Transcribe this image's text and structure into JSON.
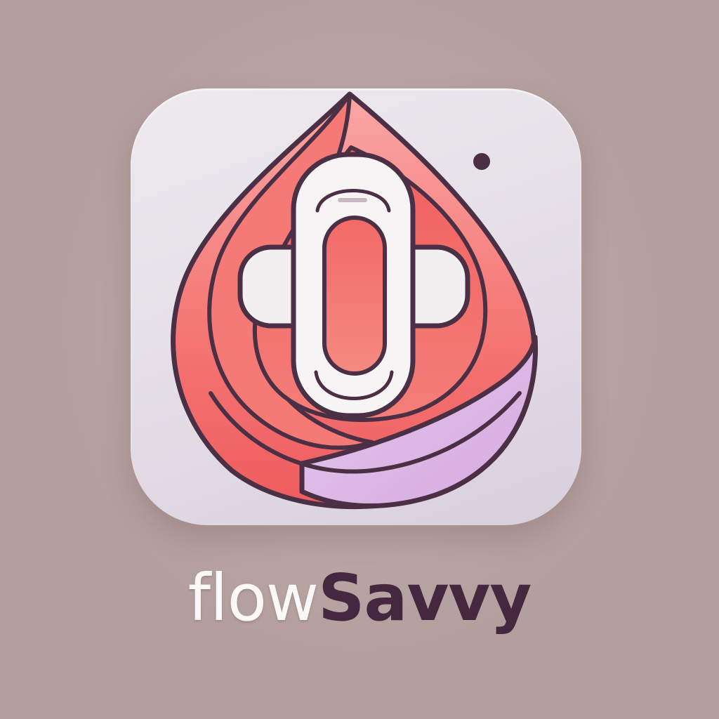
{
  "brand": {
    "wordmark_part_a": "flow",
    "wordmark_part_b": "Savvy",
    "logo_lettering": "flowSavvy"
  },
  "colors": {
    "background": "#b39f9d",
    "tile": "#ebe6ec",
    "drop_red": "#f0605f",
    "drop_pink": "#f49088",
    "accent_lavender": "#d9b3e3",
    "outline": "#4a2f45",
    "pad_white": "#f6f3f4",
    "wordmark_light": "#fbf8f8",
    "wordmark_dark": "#45283f"
  },
  "icons": [
    "blood-drop-icon",
    "sanitary-pad-icon",
    "dot-icon"
  ]
}
